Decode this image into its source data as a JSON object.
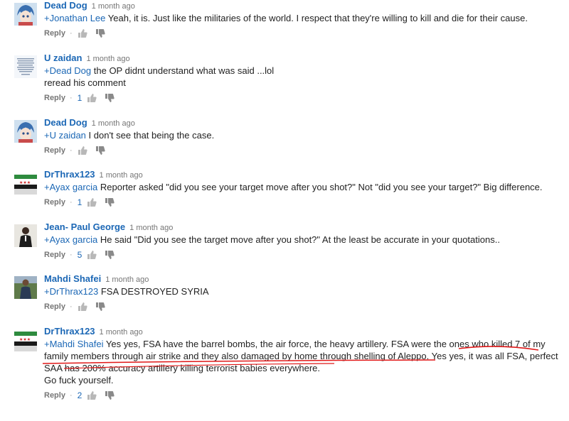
{
  "comments": [
    {
      "author": "Dead Dog",
      "time": "1 month ago",
      "mention": "+Jonathan Lee",
      "lines": [
        "Yeah, it is. Just like the militaries of the world. I respect that they're willing to kill and die for their cause."
      ],
      "reply": "Reply",
      "likes": "",
      "avatar": "anime"
    },
    {
      "author": "U zaidan",
      "time": "1 month ago",
      "mention": "+Dead Dog",
      "lines": [
        "the OP didnt understand what was said ...lol",
        "reread his comment"
      ],
      "reply": "Reply",
      "likes": "1",
      "avatar": "text"
    },
    {
      "author": "Dead Dog",
      "time": "1 month ago",
      "mention": "+U zaidan",
      "lines": [
        "I don't see that being the case."
      ],
      "reply": "Reply",
      "likes": "",
      "avatar": "anime"
    },
    {
      "author": "DrThrax123",
      "time": "1 month ago",
      "mention": "+Ayax garcia",
      "lines": [
        "Reporter asked \"did you see your target move after you shot?\" Not \"did you see your target?\" Big difference."
      ],
      "reply": "Reply",
      "likes": "1",
      "avatar": "flag"
    },
    {
      "author": "Jean- Paul George",
      "time": "1 month ago",
      "mention": "+Ayax garcia",
      "lines": [
        "He said \"Did you see the target move after you shot?\" At the least be accurate in your quotations.."
      ],
      "reply": "Reply",
      "likes": "5",
      "avatar": "person-dark"
    },
    {
      "author": "Mahdi Shafei",
      "time": "1 month ago",
      "mention": "+DrThrax123",
      "lines": [
        "FSA DESTROYED SYRIA"
      ],
      "reply": "Reply",
      "likes": "",
      "avatar": "person-green"
    },
    {
      "author": "DrThrax123",
      "time": "1 month ago",
      "mention": "+Mahdi Shafei",
      "lines": [
        "Yes yes, FSA have the barrel bombs, the air force, the heavy artillery. FSA were the ones who killed 7 of my",
        "family members through air strike and they also damaged by home through shelling of Aleppo. Yes yes, it was all FSA, perfect",
        "SAA has 200% accuracy artillery killing terrorist babies everywhere.",
        "Go fuck yourself."
      ],
      "reply": "Reply",
      "likes": "2",
      "avatar": "flag"
    }
  ]
}
